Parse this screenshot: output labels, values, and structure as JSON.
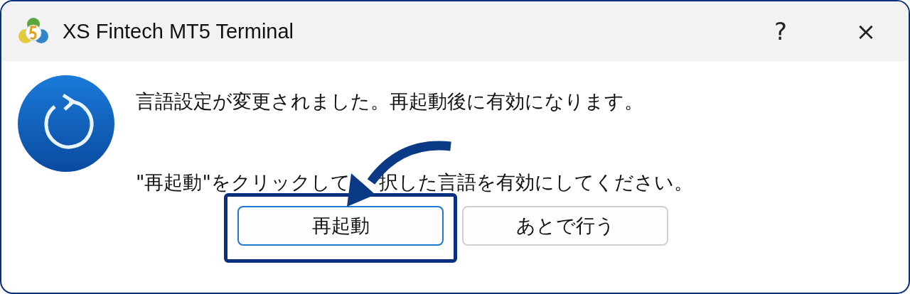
{
  "window": {
    "title": "XS Fintech MT5 Terminal",
    "help": "?",
    "close": "×"
  },
  "message": {
    "line_1": "言語設定が変更されました。再起動後に有効になります。",
    "line_2_before_arrow": "\"再起動\"をクリックして",
    "line_2_after_arrow": "択した言語を有効にしてください。"
  },
  "buttons": [
    {
      "label": "再起動",
      "default": true,
      "highlighted": true
    },
    {
      "label": "あとで行う",
      "default": false,
      "highlighted": false
    }
  ]
}
